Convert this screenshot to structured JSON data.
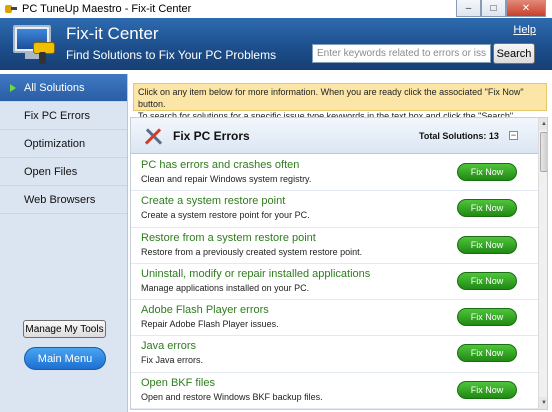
{
  "window": {
    "title": "PC TuneUp Maestro - Fix-it Center",
    "controls": {
      "minimize": "–",
      "maximize": "□",
      "close": "✕"
    }
  },
  "header": {
    "title": "Fix-it Center",
    "subtitle": "Find Solutions to Fix Your PC Problems",
    "help": "Help",
    "search": {
      "placeholder": "Enter keywords related to errors or issues",
      "value": "",
      "button": "Search"
    }
  },
  "sidebar": {
    "items": [
      {
        "label": "All Solutions",
        "active": true
      },
      {
        "label": "Fix PC Errors",
        "active": false
      },
      {
        "label": "Optimization",
        "active": false
      },
      {
        "label": "Open Files",
        "active": false
      },
      {
        "label": "Web Browsers",
        "active": false
      }
    ],
    "manage_button": "Manage My Tools",
    "main_menu_button": "Main Menu"
  },
  "info": {
    "line1": "Click on any item below for more information.  When you are ready click the associated \"Fix Now\" button.",
    "line2": "To search for solutions for a specific issue type keywords in the text box and click the \"Search\" button."
  },
  "category": {
    "title": "Fix PC Errors",
    "total": "Total Solutions: 13",
    "collapse": "−"
  },
  "solutions": [
    {
      "title": "PC has errors and crashes often",
      "desc": "Clean and repair Windows system registry.",
      "button": "Fix Now"
    },
    {
      "title": "Create a system restore point",
      "desc": "Create a system restore point for your PC.",
      "button": "Fix Now"
    },
    {
      "title": "Restore from a system restore point",
      "desc": "Restore from a previously created system restore point.",
      "button": "Fix Now"
    },
    {
      "title": "Uninstall, modify or repair installed applications",
      "desc": "Manage applications installed on your PC.",
      "button": "Fix Now"
    },
    {
      "title": "Adobe Flash Player errors",
      "desc": "Repair Adobe Flash Player issues.",
      "button": "Fix Now"
    },
    {
      "title": "Java errors",
      "desc": "Fix Java errors.",
      "button": "Fix Now"
    },
    {
      "title": "Open BKF files",
      "desc": "Open and restore Windows BKF backup files.",
      "button": "Fix Now"
    }
  ],
  "colors": {
    "header": "#1d4f8d",
    "accent_green": "#2e7d1e",
    "info_bg": "#fbe6a8",
    "sidebar_bg": "#dbe5f2"
  }
}
